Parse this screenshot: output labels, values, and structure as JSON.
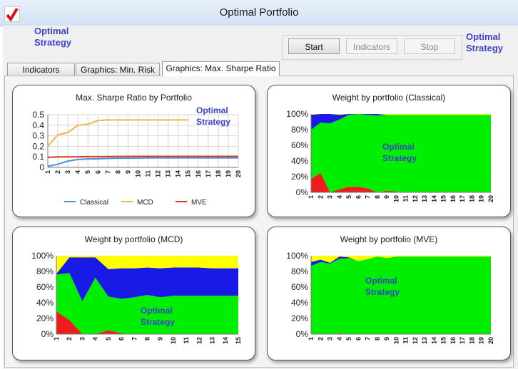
{
  "window": {
    "title": "Optimal Portfolio"
  },
  "brand": {
    "line1": "Optimal",
    "line2": "Strategy"
  },
  "buttons": {
    "start": "Start",
    "indicators": "Indicators",
    "stop": "Stop"
  },
  "tabs": [
    "Indicators",
    "Graphics: Min. Risk",
    "Graphics: Max. Sharpe Ratio"
  ],
  "colors": {
    "green": "#00ee00",
    "blue": "#1a1ae6",
    "red": "#ee1c1c",
    "yellow": "#ffff00",
    "classical": "#4a90d9",
    "mcd": "#f5b342",
    "mve": "#d9381e"
  },
  "chart_data": [
    {
      "type": "line",
      "title": "Max. Sharpe Ratio by Portfolio",
      "x": [
        1,
        2,
        3,
        4,
        5,
        6,
        7,
        8,
        9,
        10,
        11,
        12,
        13,
        14,
        15,
        16,
        17,
        18,
        19,
        20
      ],
      "ylim": [
        0,
        0.5
      ],
      "yticks": [
        "0",
        "0.1",
        "0.2",
        "0.3",
        "0.4",
        "0.5"
      ],
      "legend_position": "bottom",
      "grid": true,
      "series": [
        {
          "name": "Classical",
          "values": [
            0.01,
            0.03,
            0.06,
            0.075,
            0.08,
            0.082,
            0.085,
            0.087,
            0.088,
            0.089,
            0.09,
            0.09,
            0.09,
            0.09,
            0.09,
            0.09,
            0.09,
            0.09,
            0.09,
            0.09
          ]
        },
        {
          "name": "MCD",
          "values": [
            0.2,
            0.31,
            0.33,
            0.4,
            0.41,
            0.445,
            0.45,
            0.45,
            0.45,
            0.45,
            0.45,
            0.45,
            0.45,
            0.45,
            0.45
          ]
        },
        {
          "name": "MVE",
          "values": [
            0.095,
            0.1,
            0.1,
            0.1,
            0.102,
            0.102,
            0.103,
            0.104,
            0.105,
            0.105,
            0.105,
            0.105,
            0.105,
            0.105,
            0.105,
            0.105,
            0.105,
            0.105,
            0.105,
            0.105
          ]
        }
      ]
    },
    {
      "type": "area",
      "title": "Weight by portfolio (Classical)",
      "x": [
        1,
        2,
        3,
        4,
        5,
        6,
        7,
        8,
        9,
        10,
        11,
        12,
        13,
        14,
        15,
        16,
        17,
        18,
        19,
        20
      ],
      "yticks": [
        "0%",
        "20%",
        "40%",
        "60%",
        "80%",
        "100%"
      ],
      "stacked": true,
      "series": [
        {
          "name": "red",
          "values": [
            17,
            25,
            0,
            4,
            7,
            7,
            5,
            0,
            2,
            1,
            0,
            0,
            0,
            0,
            0,
            0,
            0,
            0,
            0,
            0
          ]
        },
        {
          "name": "green",
          "values": [
            63,
            64,
            88,
            89,
            92,
            93,
            94,
            98,
            97,
            98,
            99,
            99,
            99,
            99,
            99,
            99,
            99,
            99,
            99,
            99
          ]
        },
        {
          "name": "blue",
          "values": [
            19,
            11,
            12,
            6,
            1,
            0,
            1,
            2,
            0,
            0,
            0,
            0,
            0,
            0,
            0,
            0,
            0,
            0,
            0,
            0
          ]
        },
        {
          "name": "yellow",
          "values": [
            1,
            0,
            0,
            1,
            0,
            0,
            0,
            0,
            1,
            1,
            1,
            1,
            1,
            1,
            1,
            1,
            1,
            1,
            1,
            1
          ]
        }
      ]
    },
    {
      "type": "area",
      "title": "Weight by portfolio (MCD)",
      "x": [
        1,
        2,
        3,
        4,
        5,
        6,
        7,
        8,
        9,
        10,
        11,
        12,
        13,
        14,
        15
      ],
      "yticks": [
        "0%",
        "20%",
        "40%",
        "60%",
        "80%",
        "100%"
      ],
      "stacked": true,
      "series": [
        {
          "name": "red",
          "values": [
            29,
            18,
            0,
            0,
            5,
            1,
            0,
            0,
            0,
            0,
            0,
            0,
            0,
            0,
            0
          ]
        },
        {
          "name": "green",
          "values": [
            47,
            60,
            42,
            72,
            43,
            44,
            47,
            50,
            47,
            49,
            49,
            49,
            49,
            49,
            49
          ]
        },
        {
          "name": "blue",
          "values": [
            1,
            20,
            56,
            26,
            35,
            39,
            37,
            35,
            37,
            36,
            36,
            36,
            35,
            35,
            35
          ]
        },
        {
          "name": "yellow",
          "values": [
            23,
            2,
            2,
            2,
            17,
            16,
            16,
            15,
            16,
            15,
            15,
            15,
            16,
            16,
            16
          ]
        }
      ]
    },
    {
      "type": "area",
      "title": "Weight by portfolio (MVE)",
      "x": [
        1,
        2,
        3,
        4,
        5,
        6,
        7,
        8,
        9,
        10,
        11,
        12,
        13,
        14,
        15,
        16,
        17,
        18,
        19,
        20
      ],
      "yticks": [
        "0%",
        "20%",
        "40%",
        "60%",
        "80%",
        "100%"
      ],
      "stacked": true,
      "series": [
        {
          "name": "red",
          "values": [
            0,
            0,
            0,
            1,
            0,
            0,
            0,
            0,
            0,
            0,
            0,
            0,
            0,
            0,
            0,
            0,
            0,
            0,
            0,
            0
          ]
        },
        {
          "name": "green",
          "values": [
            87,
            92,
            90,
            95,
            97,
            93,
            96,
            99,
            97,
            99,
            99,
            99,
            99,
            99,
            99,
            99,
            99,
            99,
            99,
            99
          ]
        },
        {
          "name": "blue",
          "values": [
            5,
            3,
            1,
            3,
            1,
            0,
            0,
            0,
            0,
            0,
            0,
            0,
            0,
            0,
            0,
            0,
            0,
            0,
            0,
            0
          ]
        },
        {
          "name": "yellow",
          "values": [
            8,
            5,
            9,
            1,
            2,
            7,
            4,
            1,
            3,
            1,
            1,
            1,
            1,
            1,
            1,
            1,
            1,
            1,
            1,
            1
          ]
        }
      ]
    }
  ]
}
